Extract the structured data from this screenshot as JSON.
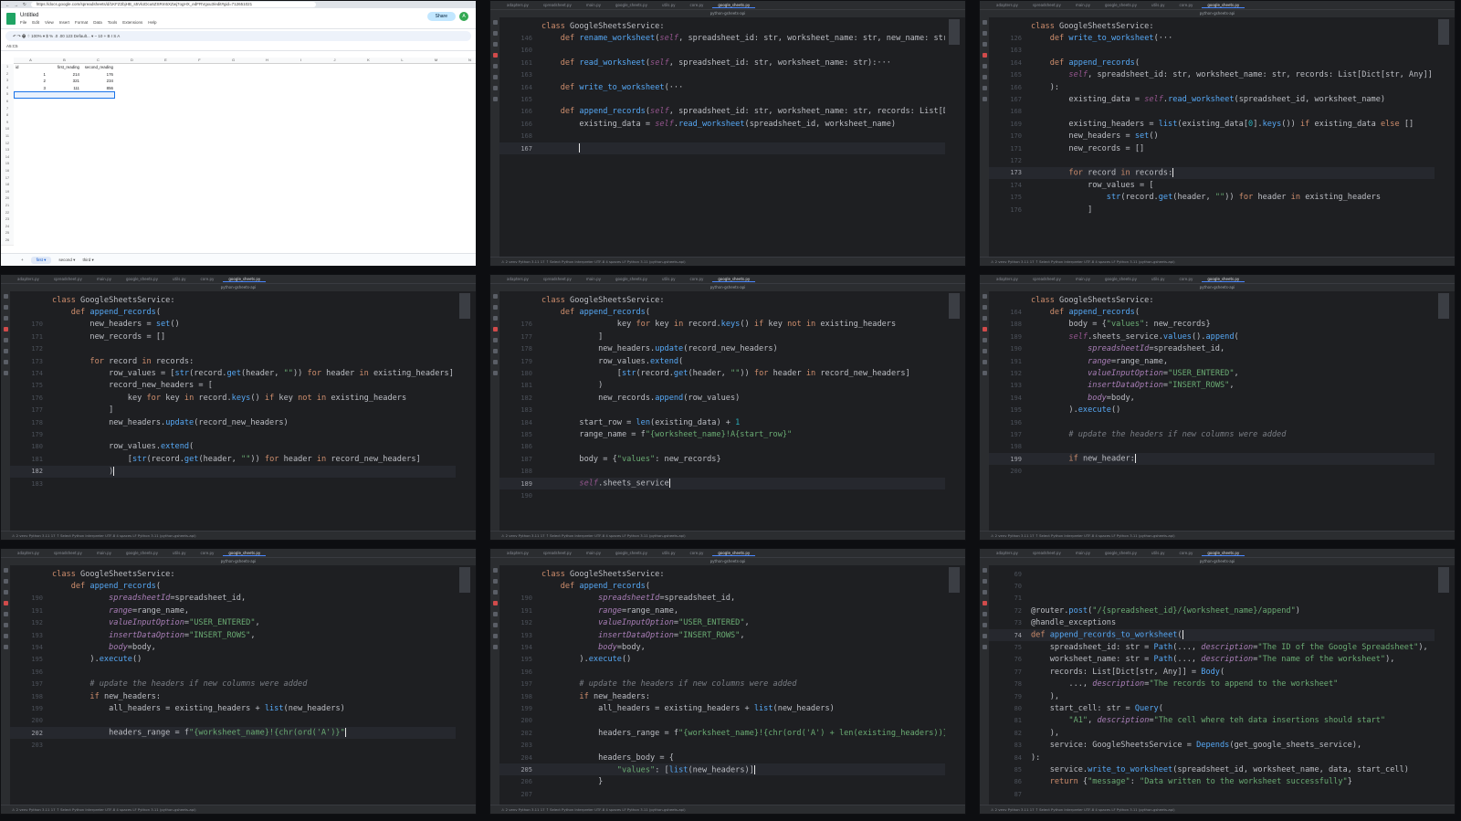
{
  "colors": {
    "background": "#1e1f22",
    "keyword": "#cf8e6d",
    "function": "#56a8f5",
    "string": "#6aab73",
    "comment": "#7a7e85"
  },
  "ide": {
    "tabs": [
      "adapters.py",
      "spreadsheet.py",
      "main.py",
      "google_sheets.py",
      "utils.py",
      "core.py",
      "google_sheets.py"
    ],
    "breadcrumb": "python-gsheets-api",
    "status": "⚠ 2  venv  Python 3.11  17 ↑  Select Python Interpreter      UTF-8  4 spaces  LF  Python 3.11 (python-gsheets-api)"
  },
  "sheets": {
    "url": "https://docs.google.com/spreadsheets/d/1KFZ2bjHB_s5ViUDcu6ZSRm5XZwj7ogHX_edFRVgxu3/edit#gid=712651021",
    "title": "Untitled",
    "menu": [
      "File",
      "Edit",
      "View",
      "Insert",
      "Format",
      "Data",
      "Tools",
      "Extensions",
      "Help"
    ],
    "share": "Share",
    "avatar": "A",
    "toolbar": "↶  ↷  🖶  ⌖   100% ▾   $   %   .0   .00   123   Default... ▾   −   10   +   B   I   S   A",
    "cell_ref": "A5:C5",
    "columns": [
      "A",
      "B",
      "C",
      "D",
      "E",
      "F",
      "G",
      "H",
      "I",
      "J",
      "K",
      "L",
      "M",
      "N"
    ],
    "rows": [
      [
        "id",
        "first_reading",
        "second_reading"
      ],
      [
        "1",
        "214",
        "176"
      ],
      [
        "2",
        "321",
        "234"
      ],
      [
        "3",
        "111",
        "856"
      ]
    ],
    "sheet_tabs": [
      "first",
      "second",
      "third"
    ]
  },
  "panes": [
    {
      "cursor_line": 167,
      "lines": [
        [
          null,
          "class GoogleSheetsService:"
        ],
        [
          146,
          "    def rename_worksheet(self, spreadsheet_id: str, worksheet_name: str, new_name: str):···"
        ],
        [
          160,
          ""
        ],
        [
          161,
          "    def read_worksheet(self, spreadsheet_id: str, worksheet_name: str):···"
        ],
        [
          163,
          ""
        ],
        [
          164,
          "    def write_to_worksheet(···"
        ],
        [
          165,
          ""
        ],
        [
          166,
          "    def append_records(self, spreadsheet_id: str, worksheet_name: str, records: List[Dict[str"
        ],
        [
          166,
          "        existing_data = self.read_worksheet(spreadsheet_id, worksheet_name)"
        ],
        [
          168,
          ""
        ],
        [
          167,
          "        "
        ]
      ]
    },
    {
      "cursor_line": 173,
      "lines": [
        [
          null,
          "class GoogleSheetsService:"
        ],
        [
          126,
          "    def write_to_worksheet(···"
        ],
        [
          163,
          ""
        ],
        [
          164,
          "    def append_records("
        ],
        [
          165,
          "        self, spreadsheet_id: str, worksheet_name: str, records: List[Dict[str, Any]]"
        ],
        [
          166,
          "    ):"
        ],
        [
          167,
          "        existing_data = self.read_worksheet(spreadsheet_id, worksheet_name)"
        ],
        [
          168,
          ""
        ],
        [
          169,
          "        existing_headers = list(existing_data[0].keys()) if existing_data else []"
        ],
        [
          170,
          "        new_headers = set()"
        ],
        [
          171,
          "        new_records = []"
        ],
        [
          172,
          ""
        ],
        [
          173,
          "        for record in records:"
        ],
        [
          174,
          "            row_values = ["
        ],
        [
          175,
          "                str(record.get(header, \"\")) for header in existing_headers"
        ],
        [
          176,
          "            ]"
        ]
      ]
    },
    {
      "cursor_line": 182,
      "lines": [
        [
          null,
          "class GoogleSheetsService:"
        ],
        [
          null,
          "    def append_records("
        ],
        [
          170,
          "        new_headers = set()"
        ],
        [
          171,
          "        new_records = []"
        ],
        [
          172,
          ""
        ],
        [
          173,
          "        for record in records:"
        ],
        [
          174,
          "            row_values = [str(record.get(header, \"\")) for header in existing_headers]"
        ],
        [
          175,
          "            record_new_headers = ["
        ],
        [
          176,
          "                key for key in record.keys() if key not in existing_headers"
        ],
        [
          177,
          "            ]"
        ],
        [
          178,
          "            new_headers.update(record_new_headers)"
        ],
        [
          179,
          ""
        ],
        [
          180,
          "            row_values.extend("
        ],
        [
          181,
          "                [str(record.get(header, \"\")) for header in record_new_headers]"
        ],
        [
          182,
          "            )"
        ],
        [
          183,
          ""
        ]
      ]
    },
    {
      "cursor_line": 189,
      "lines": [
        [
          null,
          "class GoogleSheetsService:"
        ],
        [
          null,
          "    def append_records("
        ],
        [
          176,
          "                key for key in record.keys() if key not in existing_headers"
        ],
        [
          177,
          "            ]"
        ],
        [
          178,
          "            new_headers.update(record_new_headers)"
        ],
        [
          179,
          "            row_values.extend("
        ],
        [
          180,
          "                [str(record.get(header, \"\")) for header in record_new_headers]"
        ],
        [
          181,
          "            )"
        ],
        [
          182,
          "            new_records.append(row_values)"
        ],
        [
          183,
          ""
        ],
        [
          184,
          "        start_row = len(existing_data) + 1"
        ],
        [
          185,
          "        range_name = f\"{worksheet_name}!A{start_row}\""
        ],
        [
          186,
          ""
        ],
        [
          187,
          "        body = {\"values\": new_records}"
        ],
        [
          188,
          ""
        ],
        [
          189,
          "        self.sheets_service"
        ],
        [
          190,
          ""
        ]
      ]
    },
    {
      "cursor_line": 199,
      "lines": [
        [
          null,
          "class GoogleSheetsService:"
        ],
        [
          164,
          "    def append_records("
        ],
        [
          188,
          "        body = {\"values\": new_records}"
        ],
        [
          189,
          "        self.sheets_service.values().append("
        ],
        [
          190,
          "            spreadsheetId=spreadsheet_id,"
        ],
        [
          191,
          "            range=range_name,"
        ],
        [
          192,
          "            valueInputOption=\"USER_ENTERED\","
        ],
        [
          193,
          "            insertDataOption=\"INSERT_ROWS\","
        ],
        [
          194,
          "            body=body,"
        ],
        [
          195,
          "        ).execute()"
        ],
        [
          196,
          ""
        ],
        [
          197,
          "        # update the headers if new columns were added"
        ],
        [
          198,
          ""
        ],
        [
          199,
          "        if new_header:"
        ],
        [
          200,
          ""
        ]
      ]
    },
    {
      "cursor_line": 202,
      "lines": [
        [
          null,
          "class GoogleSheetsService:"
        ],
        [
          null,
          "    def append_records("
        ],
        [
          190,
          "            spreadsheetId=spreadsheet_id,"
        ],
        [
          191,
          "            range=range_name,"
        ],
        [
          192,
          "            valueInputOption=\"USER_ENTERED\","
        ],
        [
          193,
          "            insertDataOption=\"INSERT_ROWS\","
        ],
        [
          194,
          "            body=body,"
        ],
        [
          195,
          "        ).execute()"
        ],
        [
          196,
          ""
        ],
        [
          197,
          "        # update the headers if new columns were added"
        ],
        [
          198,
          "        if new_headers:"
        ],
        [
          199,
          "            all_headers = existing_headers + list(new_headers)"
        ],
        [
          200,
          ""
        ],
        [
          202,
          "            headers_range = f\"{worksheet_name}!{chr(ord('A')}\""
        ],
        [
          203,
          ""
        ]
      ]
    },
    {
      "cursor_line": 205,
      "lines": [
        [
          null,
          "class GoogleSheetsService:"
        ],
        [
          null,
          "    def append_records("
        ],
        [
          190,
          "            spreadsheetId=spreadsheet_id,"
        ],
        [
          191,
          "            range=range_name,"
        ],
        [
          192,
          "            valueInputOption=\"USER_ENTERED\","
        ],
        [
          193,
          "            insertDataOption=\"INSERT_ROWS\","
        ],
        [
          194,
          "            body=body,"
        ],
        [
          195,
          "        ).execute()"
        ],
        [
          196,
          ""
        ],
        [
          197,
          "        # update the headers if new columns were added"
        ],
        [
          198,
          "        if new_headers:"
        ],
        [
          199,
          "            all_headers = existing_headers + list(new_headers)"
        ],
        [
          200,
          ""
        ],
        [
          202,
          "            headers_range = f\"{worksheet_name}!{chr(ord('A') + len(existing_headers))}1:{chr("
        ],
        [
          203,
          ""
        ],
        [
          204,
          "            headers_body = {"
        ],
        [
          205,
          "                \"values\": [list(new_headers)]"
        ],
        [
          206,
          "            }"
        ],
        [
          207,
          ""
        ]
      ]
    },
    {
      "cursor_line": 74,
      "lines": [
        [
          69,
          ""
        ],
        [
          70,
          ""
        ],
        [
          71,
          ""
        ],
        [
          72,
          "@router.post(\"/{spreadsheet_id}/{worksheet_name}/append\")"
        ],
        [
          73,
          "@handle_exceptions"
        ],
        [
          74,
          "def append_records_to_worksheet("
        ],
        [
          75,
          "    spreadsheet_id: str = Path(..., description=\"The ID of the Google Spreadsheet\"),"
        ],
        [
          76,
          "    worksheet_name: str = Path(..., description=\"The name of the worksheet\"),"
        ],
        [
          77,
          "    records: List[Dict[str, Any]] = Body("
        ],
        [
          78,
          "        ..., description=\"The records to append to the worksheet\""
        ],
        [
          79,
          "    ),"
        ],
        [
          80,
          "    start_cell: str = Query("
        ],
        [
          81,
          "        \"A1\", description=\"The cell where teh data insertions should start\""
        ],
        [
          82,
          "    ),"
        ],
        [
          83,
          "    service: GoogleSheetsService = Depends(get_google_sheets_service),"
        ],
        [
          84,
          "):"
        ],
        [
          85,
          "    service.write_to_worksheet(spreadsheet_id, worksheet_name, data, start_cell)"
        ],
        [
          86,
          "    return {\"message\": \"Data written to the worksheet successfully\"}"
        ],
        [
          87,
          ""
        ]
      ]
    }
  ]
}
